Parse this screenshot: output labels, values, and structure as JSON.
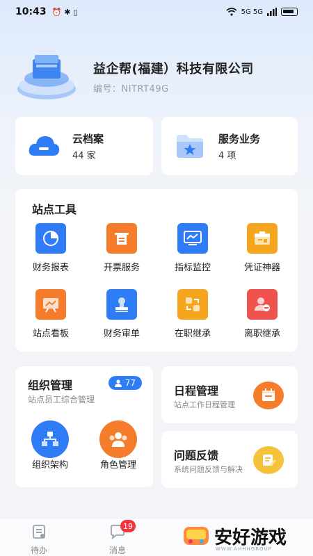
{
  "status_bar": {
    "time": "10:43",
    "network": "5G 5G"
  },
  "company": {
    "name": "益企帮(福建）科技有限公司",
    "code": "编号：NITRT49G"
  },
  "summary_cards": [
    {
      "title": "云档案",
      "value": "44 家"
    },
    {
      "title": "服务业务",
      "value": "4 项"
    }
  ],
  "station_tools": {
    "title": "站点工具",
    "items": [
      {
        "label": "财务报表",
        "color": "#2f7df6",
        "icon": "pie-chart-icon"
      },
      {
        "label": "开票服务",
        "color": "#f47c2b",
        "icon": "invoice-icon"
      },
      {
        "label": "指标监控",
        "color": "#2f7df6",
        "icon": "monitor-icon"
      },
      {
        "label": "凭证神器",
        "color": "#f6a51e",
        "icon": "voucher-icon"
      },
      {
        "label": "站点看板",
        "color": "#f47c2b",
        "icon": "board-icon"
      },
      {
        "label": "财务审单",
        "color": "#2f7df6",
        "icon": "stamp-icon"
      },
      {
        "label": "在职继承",
        "color": "#f6a51e",
        "icon": "transfer-icon"
      },
      {
        "label": "离职继承",
        "color": "#f0524d",
        "icon": "user-leave-icon"
      }
    ]
  },
  "org": {
    "title": "组织管理",
    "subtitle": "站点员工综合管理",
    "count": "77",
    "items": [
      {
        "label": "组织架构",
        "color": "#2f7df6",
        "icon": "org-chart-icon"
      },
      {
        "label": "角色管理",
        "color": "#f47c2b",
        "icon": "users-icon"
      }
    ]
  },
  "schedule": {
    "title": "日程管理",
    "subtitle": "站点工作日程管理",
    "color": "#f47c2b",
    "icon": "calendar-icon"
  },
  "feedback": {
    "title": "问题反馈",
    "subtitle": "系统问题反馈与解决",
    "color": "#f6c23a",
    "icon": "edit-note-icon"
  },
  "tabbar": {
    "items": [
      {
        "label": "待办"
      },
      {
        "label": "消息",
        "badge": "19"
      }
    ]
  },
  "watermark": {
    "text": "安好游戏",
    "sub": "WWW.AHHHGROUP"
  }
}
